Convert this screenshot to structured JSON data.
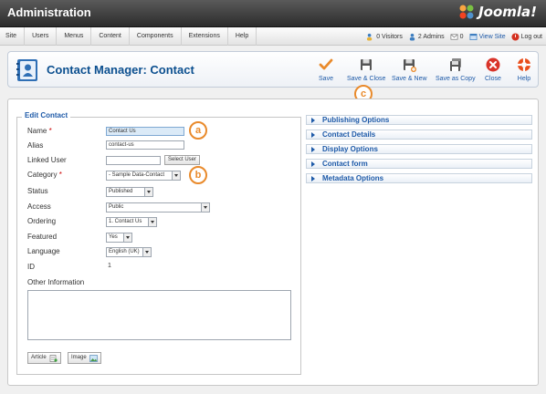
{
  "header": {
    "title": "Administration",
    "brand": "Joomla!"
  },
  "menu": [
    "Site",
    "Users",
    "Menus",
    "Content",
    "Components",
    "Extensions",
    "Help"
  ],
  "status": {
    "visitors": "0 Visitors",
    "admins": "2 Admins",
    "messages": "0",
    "view_site": "View Site",
    "logout": "Log out"
  },
  "toolbar": {
    "title": "Contact Manager: Contact",
    "buttons": {
      "save": "Save",
      "save_close": "Save & Close",
      "save_new": "Save & New",
      "save_copy": "Save as Copy",
      "close": "Close",
      "help": "Help"
    }
  },
  "markers": {
    "a": "a",
    "b": "b",
    "c": "c"
  },
  "form": {
    "legend": "Edit Contact",
    "labels": {
      "name": "Name",
      "alias": "Alias",
      "linked_user": "Linked User",
      "category": "Category",
      "status": "Status",
      "access": "Access",
      "ordering": "Ordering",
      "featured": "Featured",
      "language": "Language",
      "id": "ID",
      "other_info": "Other Information"
    },
    "required_mark": "*",
    "values": {
      "name": "Contact Us",
      "alias": "contact-us",
      "linked_user": "",
      "category": "- Sample Data-Contact",
      "status": "Published",
      "access": "Public",
      "ordering": "1. Contact Us",
      "featured": "Yes",
      "language": "English (UK)",
      "id": "1"
    },
    "select_user_button": "Select User",
    "editor_buttons": {
      "article": "Article",
      "image": "Image"
    }
  },
  "panes": [
    "Publishing Options",
    "Contact Details",
    "Display Options",
    "Contact form",
    "Metadata Options"
  ],
  "colors": {
    "accent": "#1e5aa8",
    "marker": "#e98a2b",
    "title": "#0b4f8f",
    "required": "#cc0000"
  }
}
